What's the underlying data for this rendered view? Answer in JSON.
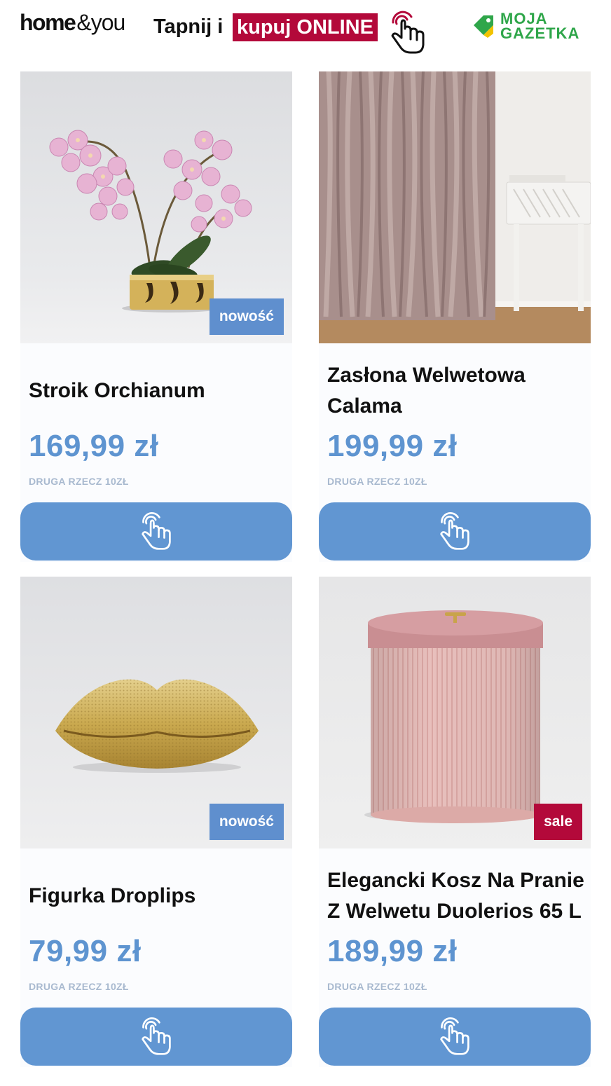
{
  "header": {
    "logo_word_home": "home",
    "logo_word_you": "&you",
    "cta_prefix": "Tapnij i",
    "cta_highlight": "kupuj ONLINE",
    "partner_logo_line1": "MOJA",
    "partner_logo_line2": "GAZETKA"
  },
  "colors": {
    "accent_blue": "#6196d2",
    "price_blue": "#5e94d0",
    "sale_red": "#b3093a",
    "partner_green": "#2fa64a"
  },
  "products": [
    {
      "title": "Stroik Orchianum",
      "price": "169,99 zł",
      "promo": "DRUGA RZECZ 10ZŁ",
      "badge": "nowość",
      "image_icon": "orchid-image"
    },
    {
      "title": "Zasłona Welwetowa Calama",
      "price": "199,99 zł",
      "promo": "DRUGA RZECZ 10ZŁ",
      "badge": "",
      "image_icon": "curtain-image"
    },
    {
      "title": "Figurka Droplips",
      "price": "79,99 zł",
      "promo": "DRUGA RZECZ 10ZŁ",
      "badge": "nowość",
      "image_icon": "lips-figurine-image"
    },
    {
      "title": "Elegancki Kosz Na Pranie Z Welwetu Duolerios 65 L",
      "price": "189,99 zł",
      "promo": "DRUGA RZECZ 10ZŁ",
      "badge": "sale",
      "image_icon": "laundry-basket-image"
    }
  ],
  "button_icon": "tap-hand-icon"
}
